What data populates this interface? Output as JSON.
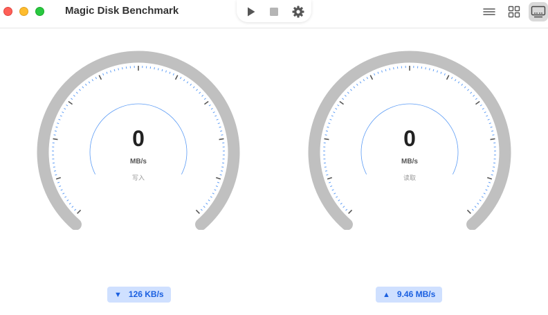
{
  "window": {
    "title": "Magic Disk Benchmark"
  },
  "toolbar": {
    "buttons": [
      {
        "icon": "play-icon"
      },
      {
        "icon": "stop-icon"
      },
      {
        "icon": "gear-icon"
      }
    ]
  },
  "view_switcher": {
    "options": [
      "list-icon",
      "grid-icon",
      "gauge-view-icon"
    ],
    "selected": "gauge-view-icon"
  },
  "gauges": {
    "write": {
      "value": "0",
      "unit": "MB/s",
      "label": "写入"
    },
    "read": {
      "value": "0",
      "unit": "MB/s",
      "label": "读取"
    }
  },
  "speeds": {
    "write": {
      "arrow": "▼",
      "text": "126 KB/s"
    },
    "read": {
      "arrow": "▲",
      "text": "9.46 MB/s"
    }
  },
  "colors": {
    "track": "#c0c0c0",
    "minor_tick": "#5b9bf5",
    "major_tick": "#555555",
    "badge_bg": "#cfe0ff",
    "badge_text": "#1a5fe0"
  }
}
